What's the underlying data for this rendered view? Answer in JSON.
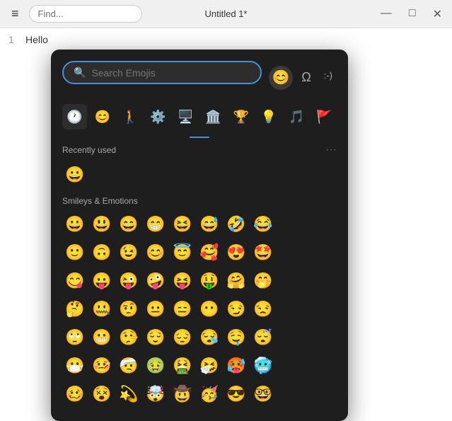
{
  "titlebar": {
    "menu_label": "≡",
    "search_placeholder": "Find...",
    "title": "Untitled 1*",
    "minimize": "—",
    "maximize": "□",
    "close": "✕"
  },
  "editor": {
    "line_number": "1",
    "line_content": "Hello"
  },
  "emoji_picker": {
    "search_placeholder": "Search Emojis",
    "search_icon": "🔍",
    "type_tabs": [
      {
        "label": "😊",
        "title": "emoji-tab"
      },
      {
        "label": "Ω",
        "title": "symbol-tab"
      },
      {
        "label": ":-)",
        "title": "kaomoji-tab"
      }
    ],
    "category_tabs": [
      {
        "icon": "🕐",
        "label": "recently-used",
        "active": true
      },
      {
        "icon": "😊",
        "label": "smileys"
      },
      {
        "icon": "🏃",
        "label": "people"
      },
      {
        "icon": "⚙️",
        "label": "activities"
      },
      {
        "icon": "🖥️",
        "label": "objects"
      },
      {
        "icon": "🏛️",
        "label": "buildings"
      },
      {
        "icon": "🏆",
        "label": "awards"
      },
      {
        "icon": "💡",
        "label": "ideas"
      },
      {
        "icon": "🎵",
        "label": "music"
      },
      {
        "icon": "🚩",
        "label": "flags"
      }
    ],
    "sections": [
      {
        "title": "Recently used",
        "has_more": true,
        "more_label": "···",
        "emojis": [
          "😀"
        ]
      },
      {
        "title": "Smileys & Emotions",
        "has_more": false,
        "emojis": [
          "😀",
          "😃",
          "😄",
          "😁",
          "😆",
          "😅",
          "🤣",
          "😂",
          "🙂",
          "🙃",
          "😉",
          "😊",
          "😇",
          "🥰",
          "😍",
          "🤩",
          "😋",
          "😛",
          "😜",
          "🤪",
          "😝",
          "🤑",
          "🤗",
          "🤭",
          "🤔",
          "🤐",
          "🤨",
          "😐",
          "😑",
          "😶",
          "😏",
          "😒",
          "🙄",
          "😬",
          "🤥",
          "😌",
          "😔",
          "😪",
          "🤤",
          "😴",
          "😷",
          "🤒",
          "🤕",
          "🤢",
          "🤮",
          "🤧",
          "🥵",
          "🥶",
          "🥴",
          "😵",
          "💫",
          "🤯",
          "🤠",
          "🥳",
          "😎",
          "🤓"
        ]
      }
    ]
  }
}
